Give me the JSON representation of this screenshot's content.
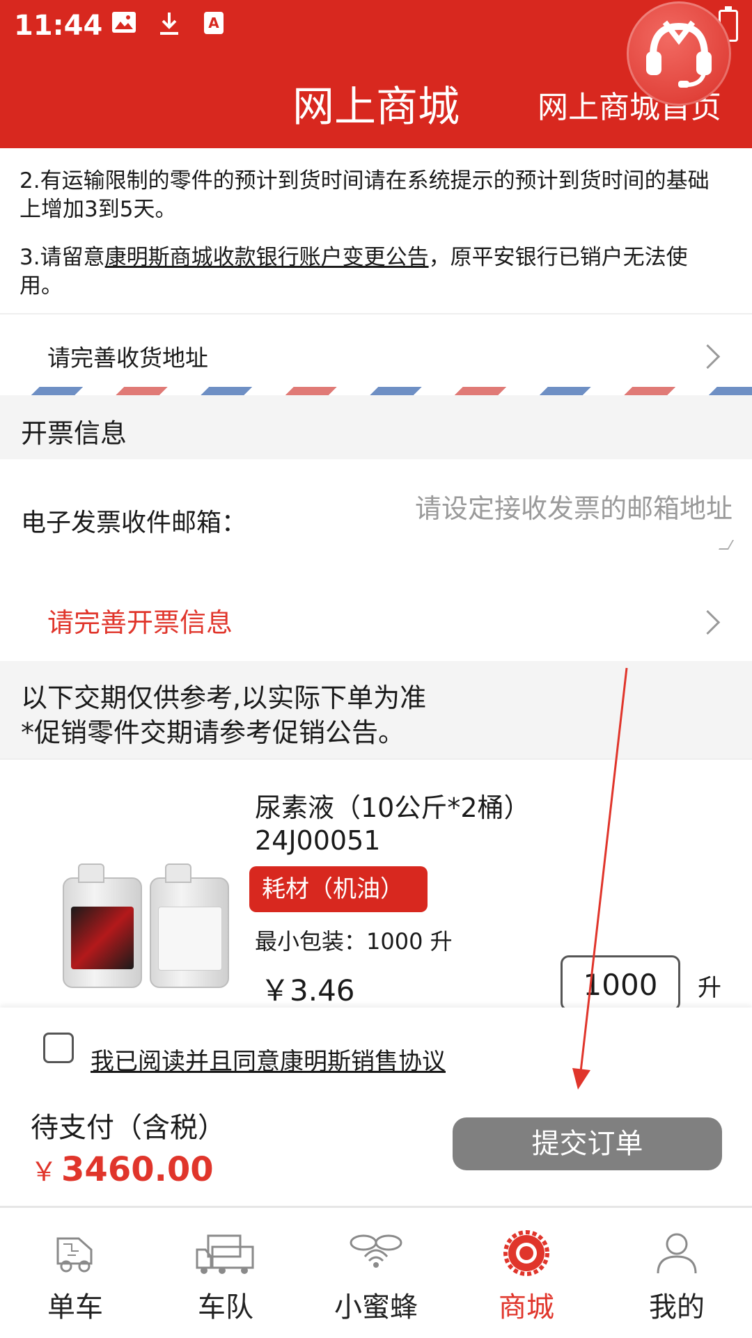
{
  "status_bar": {
    "time": "11:44"
  },
  "header": {
    "title": "网上商城",
    "right_link": "网上商城首页"
  },
  "notice": {
    "line2": "2.有运输限制的零件的预计到货时间请在系统提示的预计到货时间的基础上增加3到5天。",
    "line3_prefix": "3.请留意",
    "line3_link": "康明斯商城收款银行账户变更公告",
    "line3_suffix": "，原平安银行已销户无法使用。"
  },
  "address_row": {
    "label": "请完善收货地址"
  },
  "invoice": {
    "section_title": "开票信息",
    "email_label": "电子发票收件邮箱：",
    "email_value": "",
    "email_placeholder": "请设定接收发票的邮箱地址",
    "complete_label": "请完善开票信息"
  },
  "delivery_notice": {
    "line1": "以下交期仅供参考,以实际下单为准",
    "line2": "*促销零件交期请参考促销公告。"
  },
  "product": {
    "name": "尿素液（10公斤*2桶）",
    "code": "24J00051",
    "tag": "耗材（机油）",
    "min_pack": "最小包装：1000 升",
    "price": "￥3.46",
    "quantity": "1000",
    "unit": "升"
  },
  "agreement": {
    "label": "我已阅读并且同意康明斯销售协议",
    "checked": false
  },
  "payment": {
    "label": "待支付（含税）",
    "currency": "￥",
    "amount": "3460.00",
    "submit": "提交订单"
  },
  "tabs": [
    {
      "label": "单车",
      "icon": "truck-circuit-icon"
    },
    {
      "label": "车队",
      "icon": "fleet-trucks-icon"
    },
    {
      "label": "小蜜蜂",
      "icon": "bee-wifi-icon"
    },
    {
      "label": "商城",
      "icon": "gear-shop-icon",
      "active": true
    },
    {
      "label": "我的",
      "icon": "user-icon"
    }
  ],
  "colors": {
    "brand_red": "#d8281f",
    "link_red": "#e0352b",
    "button_gray": "#808080"
  }
}
